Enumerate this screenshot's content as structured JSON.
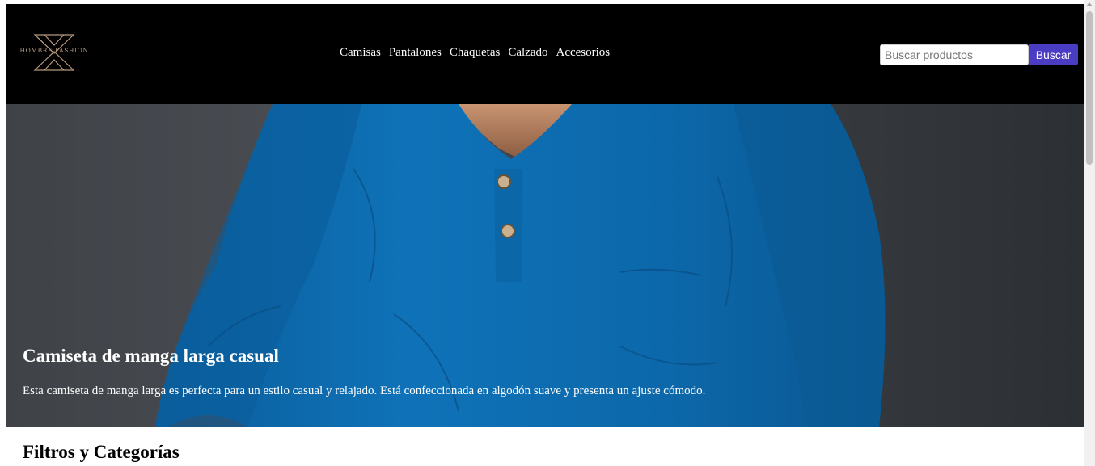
{
  "brand": {
    "logo_text": "HOMBRE FASHION"
  },
  "nav": {
    "items": [
      {
        "label": "Camisas"
      },
      {
        "label": "Pantalones"
      },
      {
        "label": "Chaquetas"
      },
      {
        "label": "Calzado"
      },
      {
        "label": "Accesorios"
      }
    ]
  },
  "search": {
    "placeholder": "Buscar productos",
    "value": "",
    "button_label": "Buscar"
  },
  "hero": {
    "title": "Camiseta de manga larga casual",
    "description": "Esta camiseta de manga larga es perfecta para un estilo casual y relajado. Está confeccionada en algodón suave y presenta un ajuste cómodo.",
    "image": "blue-long-sleeve-henley-shirt"
  },
  "filters": {
    "title": "Filtros y Categorías"
  },
  "colors": {
    "header_bg": "#000000",
    "button_bg": "#4b3cc4",
    "logo_gold": "#b79a7c",
    "shirt_blue": "#0d6db0"
  }
}
